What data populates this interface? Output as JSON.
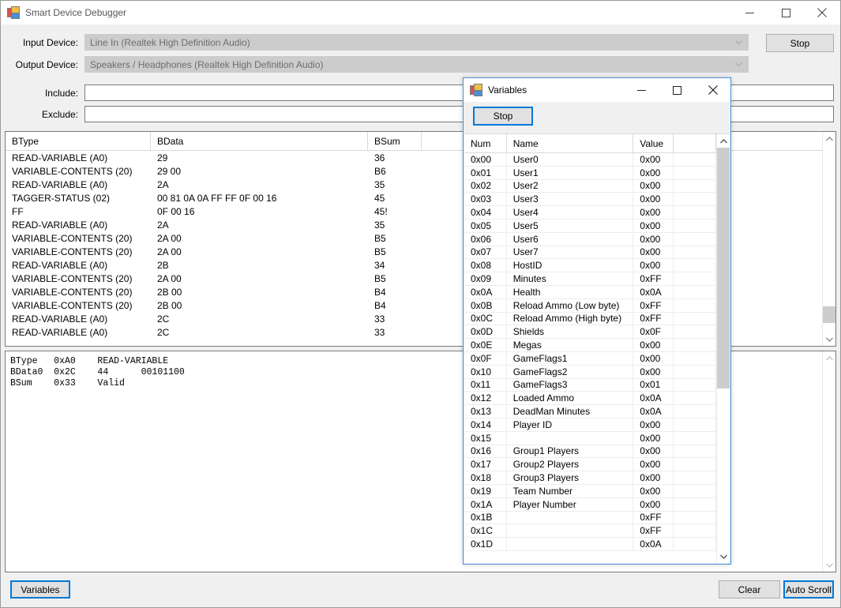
{
  "main_window": {
    "title": "Smart Device Debugger",
    "icon": "app-icon",
    "window_controls": {
      "minimize": "minimize-icon",
      "maximize": "maximize-icon",
      "close": "close-icon"
    },
    "devices": [
      {
        "label": "Input Device:",
        "value": "Line In (Realtek High Definition Audio)"
      },
      {
        "label": "Output Device:",
        "value": "Speakers / Headphones (Realtek High Definition Audio)"
      }
    ],
    "stop_button": "Stop",
    "filters": [
      {
        "label": "Include:",
        "value": "",
        "placeholder": ""
      },
      {
        "label": "Exclude:",
        "value": "",
        "placeholder": ""
      }
    ],
    "packet_list": {
      "columns": [
        "BType",
        "BData",
        "BSum",
        ""
      ],
      "rows": [
        [
          "READ-VARIABLE (A0)",
          "29",
          "36",
          ""
        ],
        [
          "VARIABLE-CONTENTS (20)",
          "29 00",
          "B6",
          ""
        ],
        [
          "READ-VARIABLE (A0)",
          "2A",
          "35",
          ""
        ],
        [
          "TAGGER-STATUS (02)",
          "00 81 0A 0A FF FF 0F 00 16",
          "45",
          ""
        ],
        [
          "FF",
          "0F 00 16",
          "45!",
          ""
        ],
        [
          "READ-VARIABLE (A0)",
          "2A",
          "35",
          ""
        ],
        [
          "VARIABLE-CONTENTS (20)",
          "2A 00",
          "B5",
          ""
        ],
        [
          "VARIABLE-CONTENTS (20)",
          "2A 00",
          "B5",
          ""
        ],
        [
          "READ-VARIABLE (A0)",
          "2B",
          "34",
          ""
        ],
        [
          "VARIABLE-CONTENTS (20)",
          "2A 00",
          "B5",
          ""
        ],
        [
          "VARIABLE-CONTENTS (20)",
          "2B 00",
          "B4",
          ""
        ],
        [
          "VARIABLE-CONTENTS (20)",
          "2B 00",
          "B4",
          ""
        ],
        [
          "READ-VARIABLE (A0)",
          "2C",
          "33",
          ""
        ],
        [
          "READ-VARIABLE (A0)",
          "2C",
          "33",
          ""
        ]
      ]
    },
    "detail_panel": {
      "lines": [
        "BType   0xA0    READ-VARIABLE",
        "BData0  0x2C    44      00101100",
        "BSum    0x33    Valid"
      ]
    },
    "bottom_buttons": {
      "variables": "Variables",
      "clear": "Clear",
      "auto_scroll": "Auto Scroll"
    }
  },
  "variables_dialog": {
    "title": "Variables",
    "icon": "app-icon",
    "window_controls": {
      "minimize": "minimize-icon",
      "maximize": "maximize-icon",
      "close": "close-icon"
    },
    "stop_button": "Stop",
    "columns": [
      "Num",
      "Name",
      "Value",
      ""
    ],
    "rows": [
      [
        "0x00",
        "User0",
        "0x00",
        ""
      ],
      [
        "0x01",
        "User1",
        "0x00",
        ""
      ],
      [
        "0x02",
        "User2",
        "0x00",
        ""
      ],
      [
        "0x03",
        "User3",
        "0x00",
        ""
      ],
      [
        "0x04",
        "User4",
        "0x00",
        ""
      ],
      [
        "0x05",
        "User5",
        "0x00",
        ""
      ],
      [
        "0x06",
        "User6",
        "0x00",
        ""
      ],
      [
        "0x07",
        "User7",
        "0x00",
        ""
      ],
      [
        "0x08",
        "HostID",
        "0x00",
        ""
      ],
      [
        "0x09",
        "Minutes",
        "0xFF",
        ""
      ],
      [
        "0x0A",
        "Health",
        "0x0A",
        ""
      ],
      [
        "0x0B",
        "Reload Ammo (Low byte)",
        "0xFF",
        ""
      ],
      [
        "0x0C",
        "Reload Ammo (High byte)",
        "0xFF",
        ""
      ],
      [
        "0x0D",
        "Shields",
        "0x0F",
        ""
      ],
      [
        "0x0E",
        "Megas",
        "0x00",
        ""
      ],
      [
        "0x0F",
        "GameFlags1",
        "0x00",
        ""
      ],
      [
        "0x10",
        "GameFlags2",
        "0x00",
        ""
      ],
      [
        "0x11",
        "GameFlags3",
        "0x01",
        ""
      ],
      [
        "0x12",
        "Loaded Ammo",
        "0x0A",
        ""
      ],
      [
        "0x13",
        "DeadMan Minutes",
        "0x0A",
        ""
      ],
      [
        "0x14",
        "Player ID",
        "0x00",
        ""
      ],
      [
        "0x15",
        "",
        "0x00",
        ""
      ],
      [
        "0x16",
        "Group1 Players",
        "0x00",
        ""
      ],
      [
        "0x17",
        "Group2 Players",
        "0x00",
        ""
      ],
      [
        "0x18",
        "Group3 Players",
        "0x00",
        ""
      ],
      [
        "0x19",
        "Team Number",
        "0x00",
        ""
      ],
      [
        "0x1A",
        "Player Number",
        "0x00",
        ""
      ],
      [
        "0x1B",
        "",
        "0xFF",
        ""
      ],
      [
        "0x1C",
        "",
        "0xFF",
        ""
      ],
      [
        "0x1D",
        "",
        "0x0A",
        ""
      ]
    ]
  },
  "colors": {
    "accent": "#0078d7",
    "dialog_border": "#4a90d9",
    "window_bg": "#f0f0f0",
    "disabled_field": "#cccccc",
    "button_face": "#e1e1e1"
  }
}
